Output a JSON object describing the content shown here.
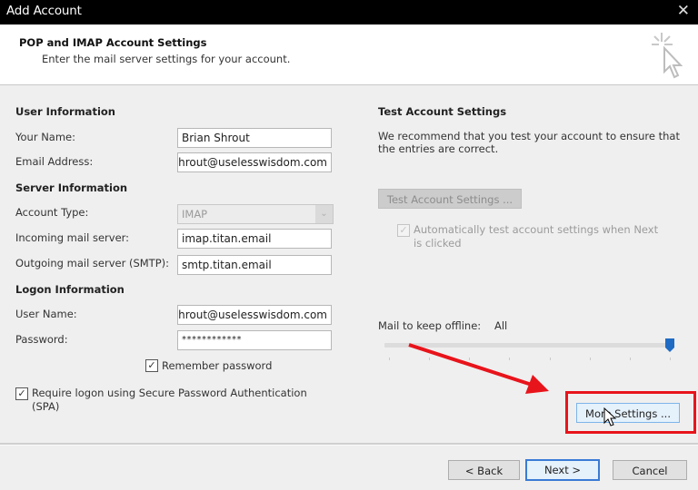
{
  "window": {
    "title": "Add Account",
    "close_icon": "close-icon"
  },
  "header": {
    "title": "POP and IMAP Account Settings",
    "subtitle": "Enter the mail server settings for your account.",
    "icon": "wizard-cursor-icon"
  },
  "user_info": {
    "heading": "User Information",
    "name_label": "Your Name:",
    "name_value": "Brian Shrout",
    "email_label": "Email Address:",
    "email_value": "bshrout@uselesswisdom.com"
  },
  "server_info": {
    "heading": "Server Information",
    "account_type_label": "Account Type:",
    "account_type_value": "IMAP",
    "incoming_label": "Incoming mail server:",
    "incoming_value": "imap.titan.email",
    "outgoing_label": "Outgoing mail server (SMTP):",
    "outgoing_value": "smtp.titan.email"
  },
  "logon_info": {
    "heading": "Logon Information",
    "username_label": "User Name:",
    "username_value": "bshrout@uselesswisdom.com",
    "password_label": "Password:",
    "password_value": "************",
    "remember_label": "Remember password",
    "remember_checked": true,
    "spa_label_line1": "Require logon using Secure Password Authentication",
    "spa_label_line2": "(SPA)",
    "spa_checked": true
  },
  "test_settings": {
    "heading": "Test Account Settings",
    "description_line1": "We recommend that you test your account to ensure that",
    "description_line2": "the entries are correct.",
    "test_button": "Test Account Settings ...",
    "auto_test_line1": "Automatically test account settings when Next",
    "auto_test_line2": "is clicked",
    "auto_test_checked": true
  },
  "offline": {
    "label": "Mail to keep offline:",
    "value": "All",
    "slider_position": 1.0,
    "slider_ticks": 8
  },
  "more_settings_button": "More Settings ...",
  "footer": {
    "back": "< Back",
    "next": "Next >",
    "cancel": "Cancel"
  },
  "annotation": {
    "color": "#e8141b",
    "target": "More Settings ..."
  }
}
